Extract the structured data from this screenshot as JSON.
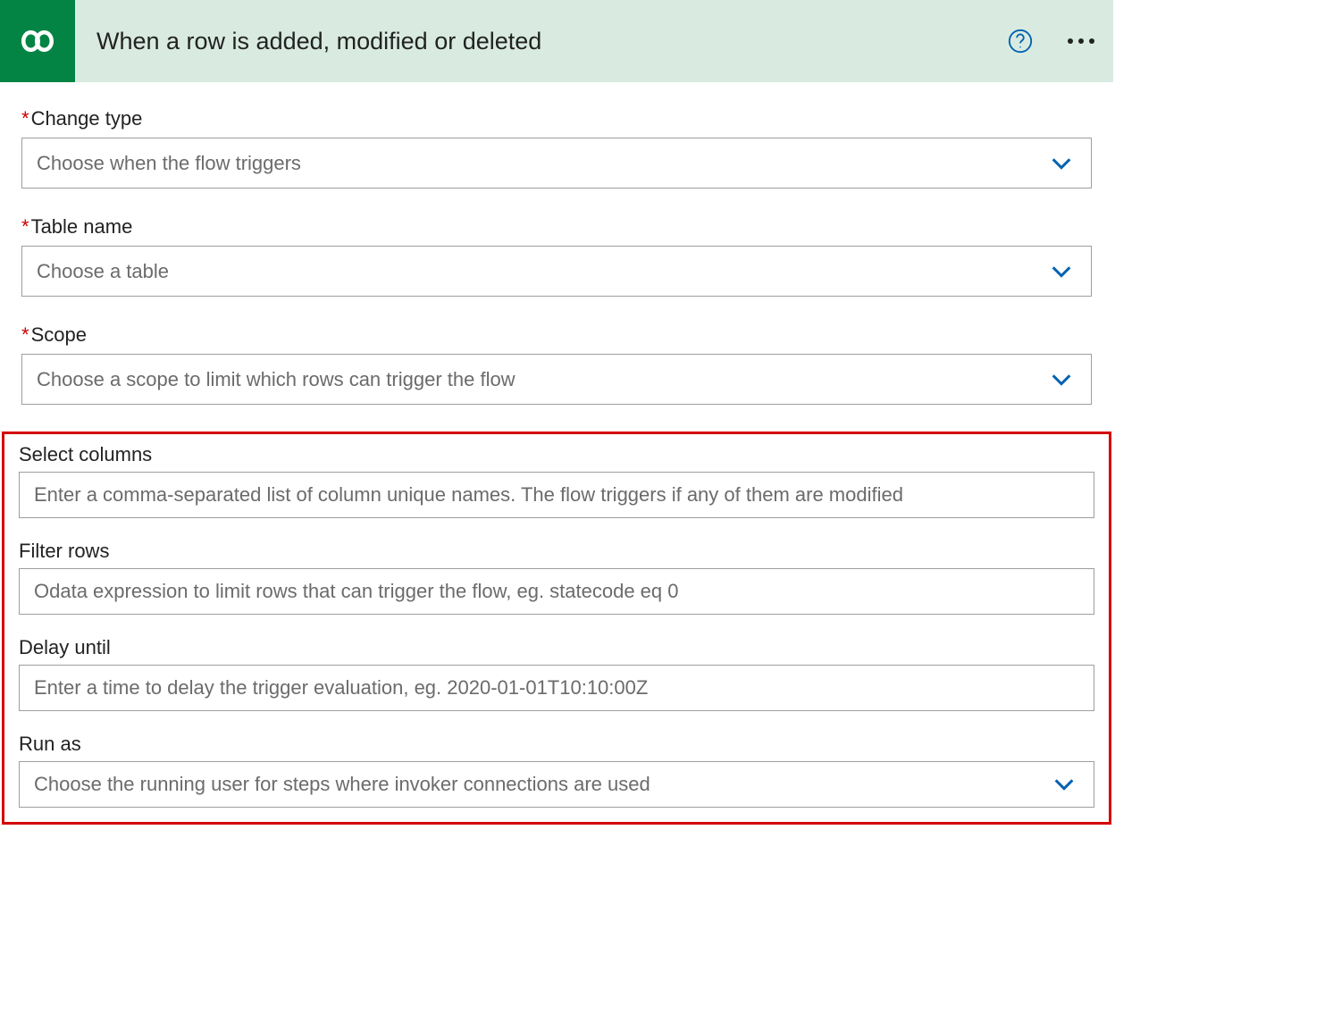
{
  "header": {
    "title": "When a row is added, modified or deleted",
    "icon_name": "dataverse-icon"
  },
  "fields": {
    "changeType": {
      "label": "Change type",
      "placeholder": "Choose when the flow triggers",
      "required": true,
      "type": "dropdown"
    },
    "tableName": {
      "label": "Table name",
      "placeholder": "Choose a table",
      "required": true,
      "type": "dropdown"
    },
    "scope": {
      "label": "Scope",
      "placeholder": "Choose a scope to limit which rows can trigger the flow",
      "required": true,
      "type": "dropdown"
    },
    "selectColumns": {
      "label": "Select columns",
      "placeholder": "Enter a comma-separated list of column unique names. The flow triggers if any of them are modified",
      "required": false,
      "type": "text"
    },
    "filterRows": {
      "label": "Filter rows",
      "placeholder": "Odata expression to limit rows that can trigger the flow, eg. statecode eq 0",
      "required": false,
      "type": "text"
    },
    "delayUntil": {
      "label": "Delay until",
      "placeholder": "Enter a time to delay the trigger evaluation, eg. 2020-01-01T10:10:00Z",
      "required": false,
      "type": "text"
    },
    "runAs": {
      "label": "Run as",
      "placeholder": "Choose the running user for steps where invoker connections are used",
      "required": false,
      "type": "dropdown"
    }
  },
  "colors": {
    "brand": "#048444",
    "headerBg": "#d9ebe1",
    "accent": "#0062b1",
    "highlight": "#d40000"
  }
}
